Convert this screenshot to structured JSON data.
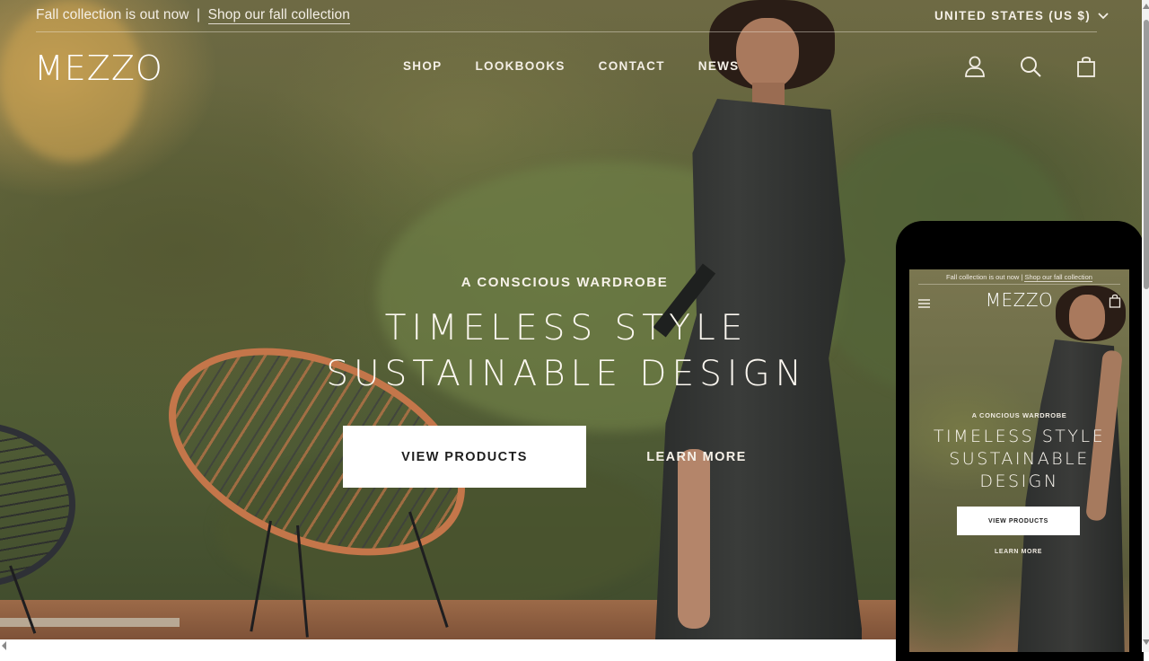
{
  "announcement": {
    "text": "Fall collection is out now",
    "separator": "|",
    "link_label": "Shop our fall collection"
  },
  "locale": {
    "label": "UNITED STATES (US $)",
    "icon": "chevron-down-icon"
  },
  "header": {
    "logo": "MEZZO",
    "nav": [
      {
        "label": "SHOP"
      },
      {
        "label": "LOOKBOOKS"
      },
      {
        "label": "CONTACT"
      },
      {
        "label": "NEWS"
      }
    ],
    "icons": [
      "account-icon",
      "search-icon",
      "shopping-bag-icon"
    ]
  },
  "hero": {
    "eyebrow": "A CONSCIOUS WARDROBE",
    "headline_line1": "TIMELESS STYLE",
    "headline_line2": "SUSTAINABLE DESIGN",
    "primary_button": "VIEW PRODUCTS",
    "secondary_button": "LEARN MORE"
  },
  "mobile_preview": {
    "announcement_text": "Fall collection is out now",
    "separator": "|",
    "announcement_link": "Shop our fall collection",
    "logo": "MEZZO",
    "eyebrow": "A CONCIOUS WARDROBE",
    "headline_line1": "TIMELESS STYLE",
    "headline_line2": "SUSTAINABLE",
    "headline_line3": "DESIGN",
    "primary_button": "VIEW PRODUCTS",
    "secondary_button": "LEARN MORE"
  },
  "colors": {
    "text_light": "#f4efe6",
    "button_bg": "#ffffff",
    "button_text": "#1e1e1e",
    "phone_frame": "#000000"
  }
}
